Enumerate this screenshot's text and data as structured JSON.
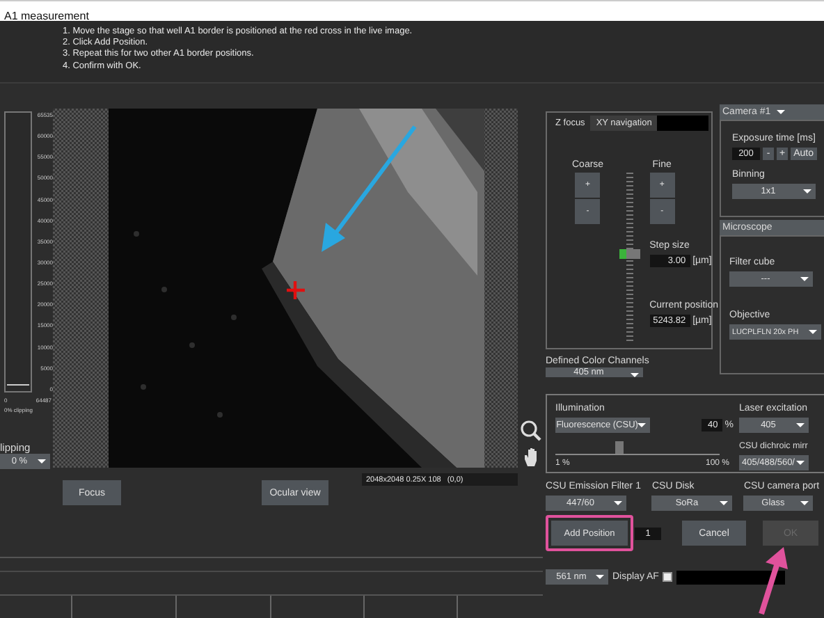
{
  "window": {
    "title": "A1 measurement"
  },
  "instructions": [
    "1. Move the stage so that well A1 border is positioned at the red cross in the live image.",
    "2. Click Add Position.",
    "3. Repeat this for two other A1 border positions.",
    "4. Confirm with OK."
  ],
  "histogram": {
    "scale": [
      "65535",
      "60000",
      "55000",
      "50000",
      "45000",
      "40000",
      "35000",
      "30000",
      "25000",
      "20000",
      "15000",
      "10000",
      "5000",
      "0"
    ],
    "min": "0",
    "max": "64487",
    "clipping_readout": "0% clipping"
  },
  "clipping": {
    "label": "lipping",
    "value": "0 %"
  },
  "view_buttons": [
    "Focus",
    "Ocular view"
  ],
  "image_info": "2048x2048 0.25X 108   (0,0)",
  "z_focus": {
    "tabs": [
      {
        "label": "Z focus",
        "selected": true
      },
      {
        "label": "XY navigation",
        "selected": false
      }
    ],
    "coarse": {
      "label": "Coarse",
      "buttons": [
        "+",
        "-"
      ]
    },
    "fine": {
      "label": "Fine",
      "buttons": [
        "+",
        "-"
      ]
    },
    "level": 0.52,
    "step_size": {
      "label": "Step size",
      "value": "3.00",
      "unit": "[µm]"
    },
    "current_position": {
      "label": "Current position",
      "value": "5243.82",
      "unit": "[µm]"
    }
  },
  "camera": {
    "title": "Camera #1",
    "exposure": {
      "label": "Exposure time [ms]",
      "value": "200",
      "buttons": [
        "-",
        "+",
        "Auto"
      ]
    },
    "binning": {
      "label": "Binning",
      "value": "1x1"
    }
  },
  "microscope": {
    "title": "Microscope",
    "filter_cube": {
      "label": "Filter cube",
      "value": "---"
    },
    "objective": {
      "label": "Objective",
      "value": "LUCPLFLN 20x PH"
    }
  },
  "color_channels": {
    "label": "Defined Color Channels",
    "value": "405 nm"
  },
  "illumination": {
    "label": "Illumination",
    "value": "Fluorescence (CSU)",
    "intensity": "40",
    "unit": "%",
    "level": 0.39,
    "min_label": "1 %",
    "max_label": "100 %"
  },
  "laser": {
    "label": "Laser excitation",
    "value": "405"
  },
  "dichroic": {
    "label": "CSU dichroic mirr",
    "value": "405/488/560/"
  },
  "emission": {
    "label": "CSU Emission Filter 1",
    "value": "447/60"
  },
  "disk": {
    "label": "CSU Disk",
    "value": "SoRa"
  },
  "camera_port": {
    "label": "CSU camera port",
    "value": "Glass"
  },
  "actions": {
    "add": "Add Position",
    "count": "1",
    "cancel": "Cancel",
    "ok": {
      "label": "OK",
      "disabled": true
    }
  },
  "af": {
    "channel": "561 nm",
    "label": "Display AF",
    "checked": false
  }
}
